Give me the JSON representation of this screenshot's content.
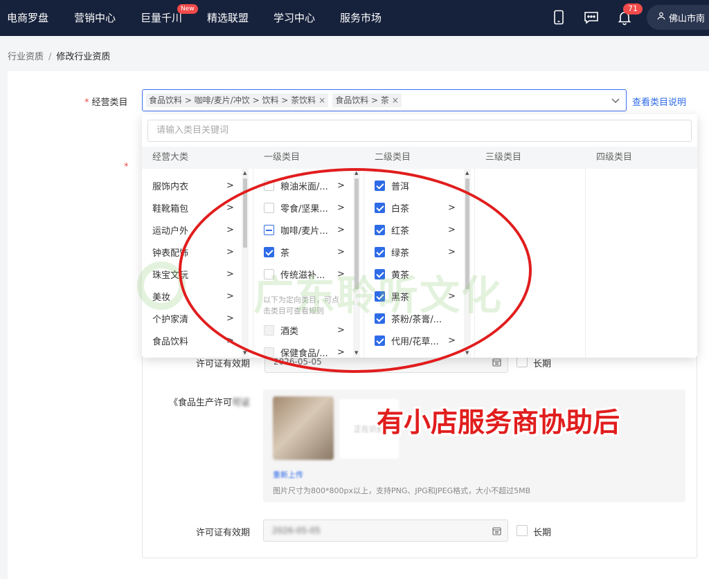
{
  "nav": {
    "items": [
      "电商罗盘",
      "营销中心",
      "巨量千川",
      "精选联盟",
      "学习中心",
      "服务市场"
    ],
    "new_badge": "New",
    "bell_count": "71",
    "user": "佛山市南"
  },
  "breadcrumb": {
    "parent": "行业资质",
    "separator": "/",
    "current": "修改行业资质"
  },
  "form": {
    "category_label": "经营类目",
    "required_mark": "*",
    "selected_tags": [
      "食品饮料 > 咖啡/麦片/冲饮 > 饮料 > 茶饮料",
      "食品饮料 > 茶"
    ],
    "tag_close": "×",
    "category_link": "查看类目说明",
    "license_validity_label": "许可证有效期",
    "license_validity_value": "2026-05-05",
    "long_term_label": "长期",
    "food_license_label": "《食品生产许可",
    "upload_link": "重新上传",
    "upload_hint": "图片尺寸为800*800px以上，支持PNG、JPG和JPEG格式，大小不超过5MB",
    "thumb_text": "正在识别",
    "second_validity_label": "许可证有效期",
    "second_validity_value": "2026-05-05",
    "second_long_term_label": "长期"
  },
  "dropdown": {
    "keyword_placeholder": "请输入类目关键词",
    "headers": [
      "经营大类",
      "一级类目",
      "二级类目",
      "三级类目",
      "四级类目"
    ],
    "col1": [
      "服饰内衣",
      "鞋靴箱包",
      "运动户外",
      "钟表配饰",
      "珠宝文玩",
      "美妆",
      "个护家清",
      "食品饮料"
    ],
    "col2": [
      {
        "label": "粮油米面/...",
        "state": "unchecked"
      },
      {
        "label": "零食/坚果...",
        "state": "unchecked"
      },
      {
        "label": "咖啡/麦片...",
        "state": "partial"
      },
      {
        "label": "茶",
        "state": "checked"
      },
      {
        "label": "传统滋补...",
        "state": "unchecked"
      }
    ],
    "directed_note": [
      "以下为定向类目，可点",
      "击类目可查看规则"
    ],
    "col2_directed": [
      {
        "label": "酒类",
        "state": "disabled"
      },
      {
        "label": "保健食品/...",
        "state": "disabled"
      }
    ],
    "col3": [
      {
        "label": "普洱",
        "has_children": false
      },
      {
        "label": "白茶",
        "has_children": true
      },
      {
        "label": "红茶",
        "has_children": true
      },
      {
        "label": "绿茶",
        "has_children": true
      },
      {
        "label": "黄茶",
        "has_children": false
      },
      {
        "label": "黑茶",
        "has_children": true
      },
      {
        "label": "茶粉/茶膏/...",
        "has_children": false
      },
      {
        "label": "代用/花草...",
        "has_children": true
      }
    ]
  },
  "overlay": {
    "watermark": "广东聆听文化",
    "caption": "有小店服务商协助后",
    "annotation_color": "#e11d1d"
  },
  "colors": {
    "nav_bg": "#16213b",
    "accent": "#2e6be6",
    "badge": "#f04a4a"
  }
}
